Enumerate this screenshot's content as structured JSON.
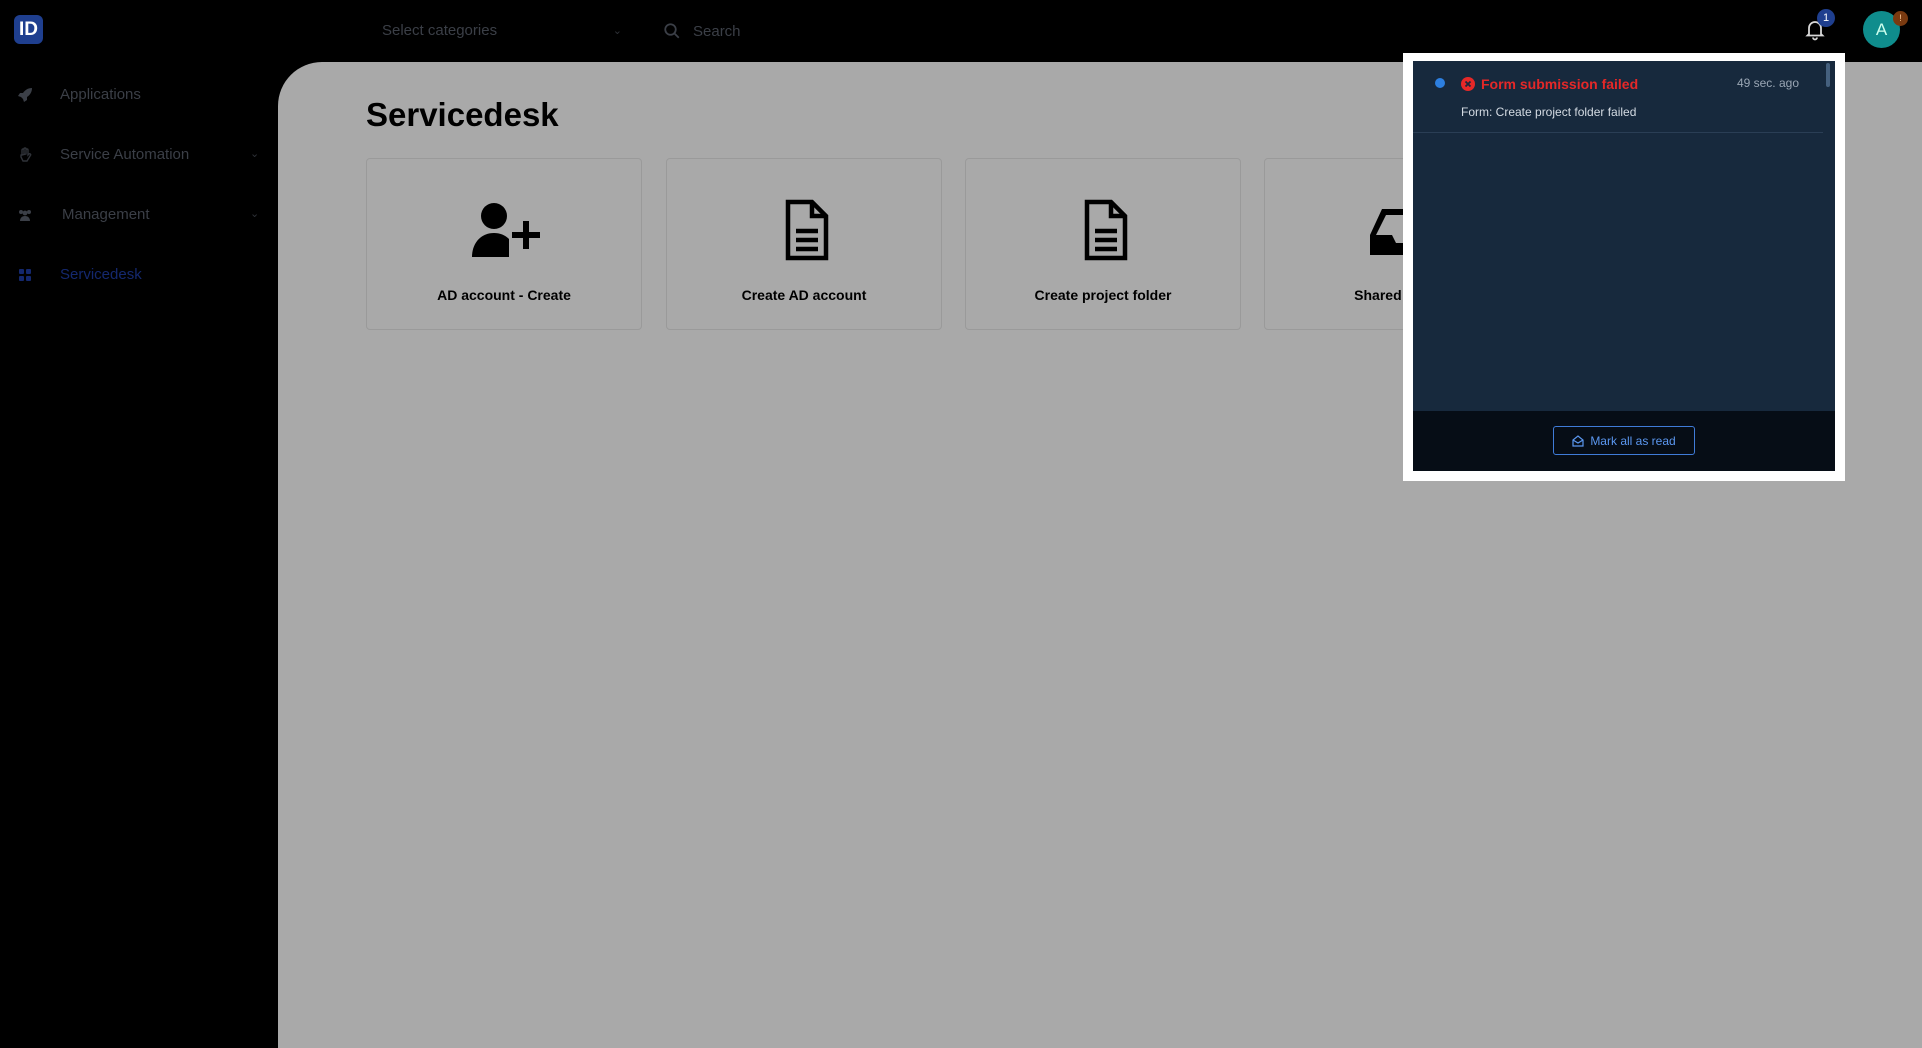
{
  "header": {
    "logo_text": "ID",
    "category_placeholder": "Select categories",
    "search_placeholder": "Search",
    "notification_count": "1",
    "avatar_initial": "A",
    "avatar_badge": "!"
  },
  "sidebar": {
    "items": [
      {
        "label": "Applications",
        "icon": "rocket-icon",
        "has_chevron": false,
        "active": false
      },
      {
        "label": "Service Automation",
        "icon": "hand-icon",
        "has_chevron": true,
        "active": false
      },
      {
        "label": "Management",
        "icon": "users-icon",
        "has_chevron": true,
        "active": false
      },
      {
        "label": "Servicedesk",
        "icon": "grid-icon",
        "has_chevron": false,
        "active": true
      }
    ]
  },
  "main": {
    "title": "Servicedesk",
    "cards": [
      {
        "label": "AD account - Create",
        "icon": "user-plus-icon"
      },
      {
        "label": "Create AD account",
        "icon": "document-icon"
      },
      {
        "label": "Create project folder",
        "icon": "document-icon"
      },
      {
        "label": "Shared Mailbo",
        "icon": "inbox-icon"
      }
    ]
  },
  "notifications": {
    "items": [
      {
        "title": "Form submission failed",
        "time": "49 sec. ago",
        "message": "Form: Create project folder failed",
        "unread": true,
        "status": "error"
      }
    ],
    "mark_all_label": "Mark all as read"
  },
  "colors": {
    "accent": "#1f3f8f",
    "error": "#e52828",
    "panel_bg": "#17293d",
    "main_bg": "#a9a9a9"
  }
}
